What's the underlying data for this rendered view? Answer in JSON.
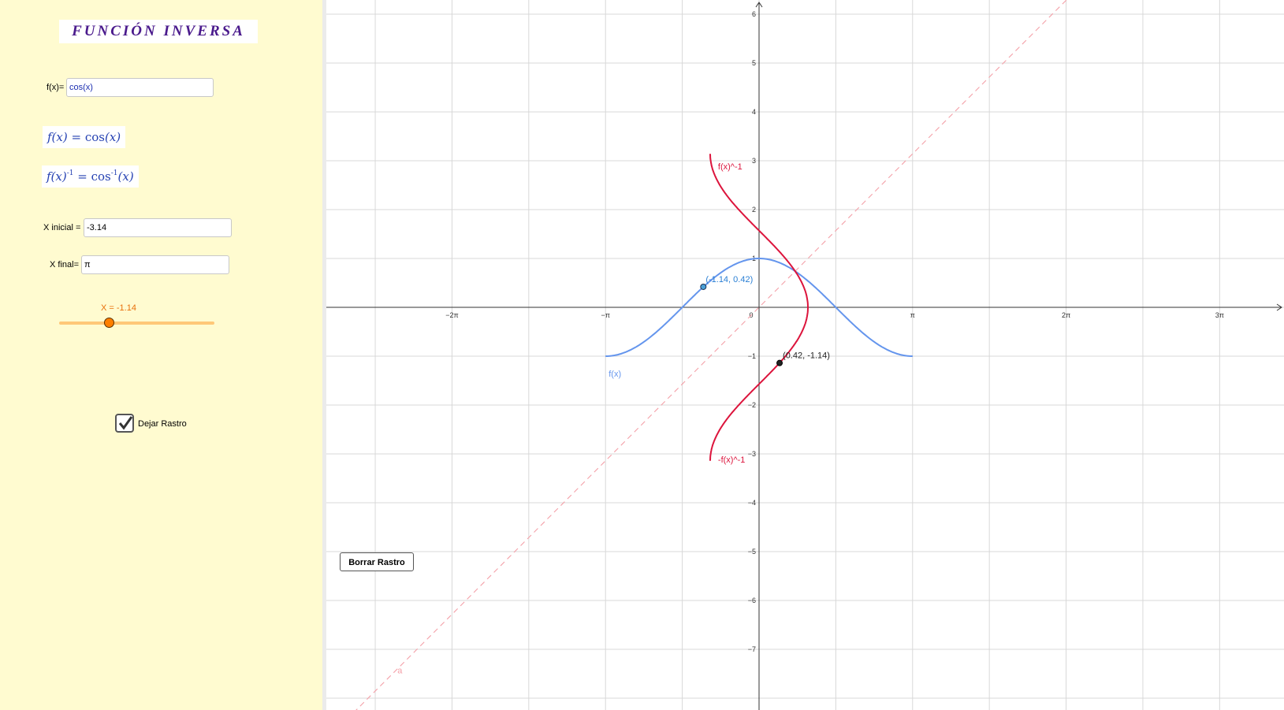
{
  "title": "FUNCIÓN INVERSA",
  "input_fx": {
    "label": "f(x)=",
    "value": "cos(x)"
  },
  "formula_f": {
    "lhs": "f(x)",
    "eq": " = ",
    "fn": "cos",
    "arg": "(x)"
  },
  "formula_inv": {
    "lhs": "f(x)",
    "exp": "-1",
    "eq": " = ",
    "fn": "cos",
    "fn_exp": "-1",
    "arg": "(x)"
  },
  "x_inicial": {
    "label": "X inicial =",
    "value": "-3.14"
  },
  "x_final": {
    "label": "X final=",
    "value": "π"
  },
  "slider": {
    "label": "X = -1.14",
    "value": -1.14,
    "min": -3.14,
    "max": 3.14159
  },
  "checkbox": {
    "label": "Dejar Rastro",
    "checked": true
  },
  "button": {
    "label": "Borrar Rastro"
  },
  "colors": {
    "panel": "#fffbd0",
    "title": "#4a1a8c",
    "f": "#6495ed",
    "inverse": "#dc143c",
    "line_a": "#f4a0a8",
    "slider": "#ff7f00"
  },
  "graph": {
    "x_tick_labels": [
      "−2π",
      "−π",
      "0",
      "π",
      "2π",
      "3π"
    ],
    "y_tick_labels": [
      "6",
      "5",
      "4",
      "3",
      "2",
      "1",
      "−1",
      "−2",
      "−3",
      "−4",
      "−5",
      "−6",
      "−7"
    ],
    "label_f": "f(x)",
    "label_inv_pos": "f(x)^-1",
    "label_inv_neg": "-f(x)^-1",
    "label_line": "a",
    "point_f_label": "(-1.14, 0.42)",
    "point_inv_label": "(0.42, -1.14)"
  },
  "chart_data": {
    "type": "line",
    "title": "",
    "xlabel": "",
    "ylabel": "",
    "xlim": [
      -8.7,
      9.85
    ],
    "ylim": [
      -7.7,
      6.3
    ],
    "series": [
      {
        "name": "f(x)",
        "function": "cos(x)",
        "domain": [
          -3.14,
          3.14159
        ]
      },
      {
        "name": "f(x)^-1",
        "function": "arccos(x) (x as function of y: x = cos(y))",
        "domain": [
          0,
          3.14159
        ]
      },
      {
        "name": "-f(x)^-1",
        "function": "x = cos(y)",
        "domain": [
          -3.14,
          0
        ]
      },
      {
        "name": "a",
        "function": "y = x",
        "style": "dashed"
      }
    ],
    "points": [
      {
        "label": "(-1.14, 0.42)",
        "x": -1.14,
        "y": 0.42
      },
      {
        "label": "(0.42, -1.14)",
        "x": 0.42,
        "y": -1.14
      }
    ]
  }
}
